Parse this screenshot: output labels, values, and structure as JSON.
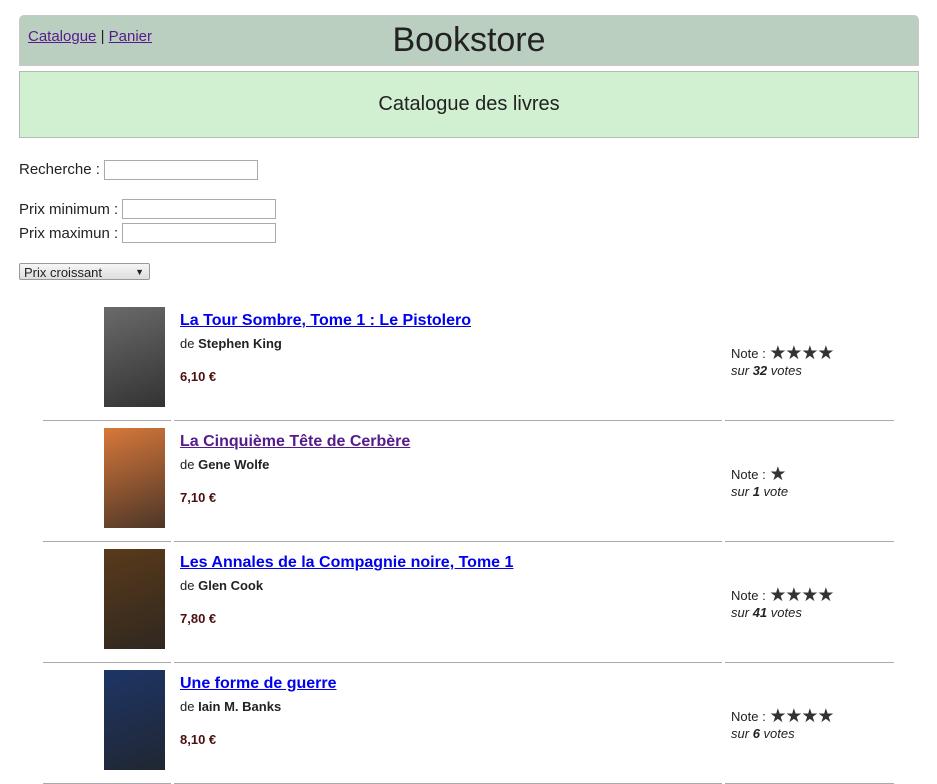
{
  "header": {
    "nav": [
      {
        "label": "Catalogue"
      },
      {
        "label": "Panier"
      }
    ],
    "separator": "|",
    "brand": "Bookstore"
  },
  "subheader": {
    "title": "Catalogue des livres"
  },
  "filters": {
    "search_label": "Recherche :",
    "search_value": "",
    "min_label": "Prix minimum :",
    "min_value": "",
    "max_label": "Prix maximun :",
    "max_value": "",
    "sort_selected": "Prix croissant"
  },
  "books": [
    {
      "title": "La Tour Sombre, Tome 1 : Le Pistolero",
      "author_prefix": "de",
      "author": "Stephen King",
      "price": "6,10 €",
      "note_label": "Note :",
      "rating": 4,
      "votes_prefix": "sur",
      "votes": "32",
      "votes_suffix": "votes",
      "cover_color": "#6a6a6a",
      "visited": false
    },
    {
      "title": "La Cinquième Tête de Cerbère",
      "author_prefix": "de",
      "author": "Gene Wolfe",
      "price": "7,10 €",
      "note_label": "Note :",
      "rating": 1,
      "votes_prefix": "sur",
      "votes": "1",
      "votes_suffix": "vote",
      "cover_color": "#d8783a",
      "visited": true
    },
    {
      "title": "Les Annales de la Compagnie noire, Tome 1",
      "author_prefix": "de",
      "author": "Glen Cook",
      "price": "7,80 €",
      "note_label": "Note :",
      "rating": 4,
      "votes_prefix": "sur",
      "votes": "41",
      "votes_suffix": "votes",
      "cover_color": "#5a3a1a",
      "visited": false
    },
    {
      "title": "Une forme de guerre",
      "author_prefix": "de",
      "author": "Iain M. Banks",
      "price": "8,10 €",
      "note_label": "Note :",
      "rating": 4,
      "votes_prefix": "sur",
      "votes": "6",
      "votes_suffix": "votes",
      "cover_color": "#1d3566",
      "visited": false
    }
  ]
}
